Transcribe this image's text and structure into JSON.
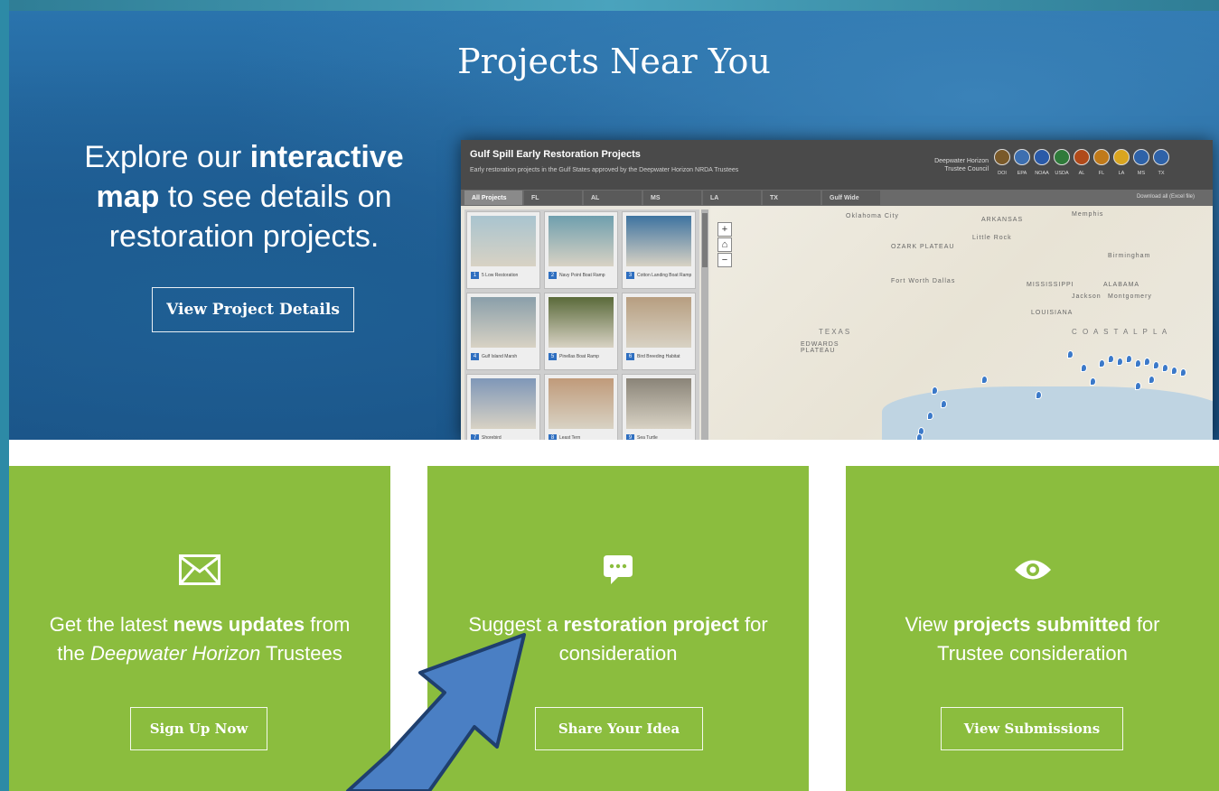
{
  "hero": {
    "title": "Projects Near You",
    "text_pre": "Explore our ",
    "text_bold1": "interactive map",
    "text_post": " to see details on restoration projects.",
    "button_label": "View Project Details"
  },
  "map": {
    "title": "Gulf Spill Early Restoration Projects",
    "subtitle": "Early restoration projects in the Gulf States approved by the Deepwater Horizon NRDA Trustees",
    "council": "Deepwater Horizon Trustee Council",
    "seals": [
      "DOI",
      "EPA",
      "NOAA",
      "USDA",
      "AL",
      "FL",
      "LA",
      "MS",
      "TX"
    ],
    "seal_colors": [
      "#7a5a2a",
      "#3d6fb0",
      "#2a5aa8",
      "#2f7a3a",
      "#b04a1a",
      "#c07a1a",
      "#d9a520",
      "#2e62a8",
      "#2e62a8"
    ],
    "tabs": [
      "All Projects",
      "FL",
      "AL",
      "MS",
      "LA",
      "TX",
      "Gulf Wide"
    ],
    "download": "Download all (Excel file)",
    "projects": [
      {
        "num": "1",
        "caption": "5 Low Restoration",
        "color": "#a9c4cf"
      },
      {
        "num": "2",
        "caption": "Navy Point Boat Ramp",
        "color": "#6f9fae"
      },
      {
        "num": "3",
        "caption": "Cotton Landing Boat Ramp",
        "color": "#3e73a0"
      },
      {
        "num": "4",
        "caption": "Gulf Island Marsh",
        "color": "#8a9faa"
      },
      {
        "num": "5",
        "caption": "Pinellas Boat Ramp",
        "color": "#5a6a3a"
      },
      {
        "num": "6",
        "caption": "Bird Breeding Habitat",
        "color": "#b79e80"
      },
      {
        "num": "7",
        "caption": "Shorebird",
        "color": "#7f97b8"
      },
      {
        "num": "8",
        "caption": "Least Tern",
        "color": "#c09a7a"
      },
      {
        "num": "9",
        "caption": "Sea Turtle",
        "color": "#8a8478"
      }
    ],
    "labels": {
      "arkansas": "ARKANSAS",
      "ozark": "OZARK PLATEAU",
      "oklahoma": "Oklahoma City",
      "memphis": "Memphis",
      "little_rock": "Little Rock",
      "mississippi": "MISSISSIPPI",
      "alabama": "ALABAMA",
      "louisiana": "LOUISIANA",
      "texas": "TEXAS",
      "edwards": "EDWARDS PLATEAU",
      "coastal": "C O A S T A L   P L A",
      "fort_worth": "Fort Worth Dallas",
      "jackson": "Jackson",
      "montgomery": "Montgomery",
      "birmingham": "Birmingham"
    }
  },
  "cards": [
    {
      "icon": "envelope-icon",
      "line1_pre": "Get the latest ",
      "line1_bold": "news updates",
      "line1_post": " from",
      "line2_pre": "the ",
      "line2_italic": "Deepwater Horizon",
      "line2_post": " Trustees",
      "button": "Sign Up Now"
    },
    {
      "icon": "speech-bubble-icon",
      "line1_pre": "Suggest a ",
      "line1_bold": "restoration project",
      "line1_post": " for",
      "line2_pre": "consideration",
      "line2_italic": "",
      "line2_post": "",
      "button": "Share Your Idea"
    },
    {
      "icon": "eye-icon",
      "line1_pre": "View ",
      "line1_bold": "projects submitted",
      "line1_post": " for",
      "line2_pre": "Trustee consideration",
      "line2_italic": "",
      "line2_post": "",
      "button": "View Submissions"
    }
  ],
  "colors": {
    "card_green": "#8bbd3e",
    "hero_blue": "#1d5a90",
    "arrow_blue": "#4a7fc4",
    "frame_teal": "#2d8aa6"
  }
}
